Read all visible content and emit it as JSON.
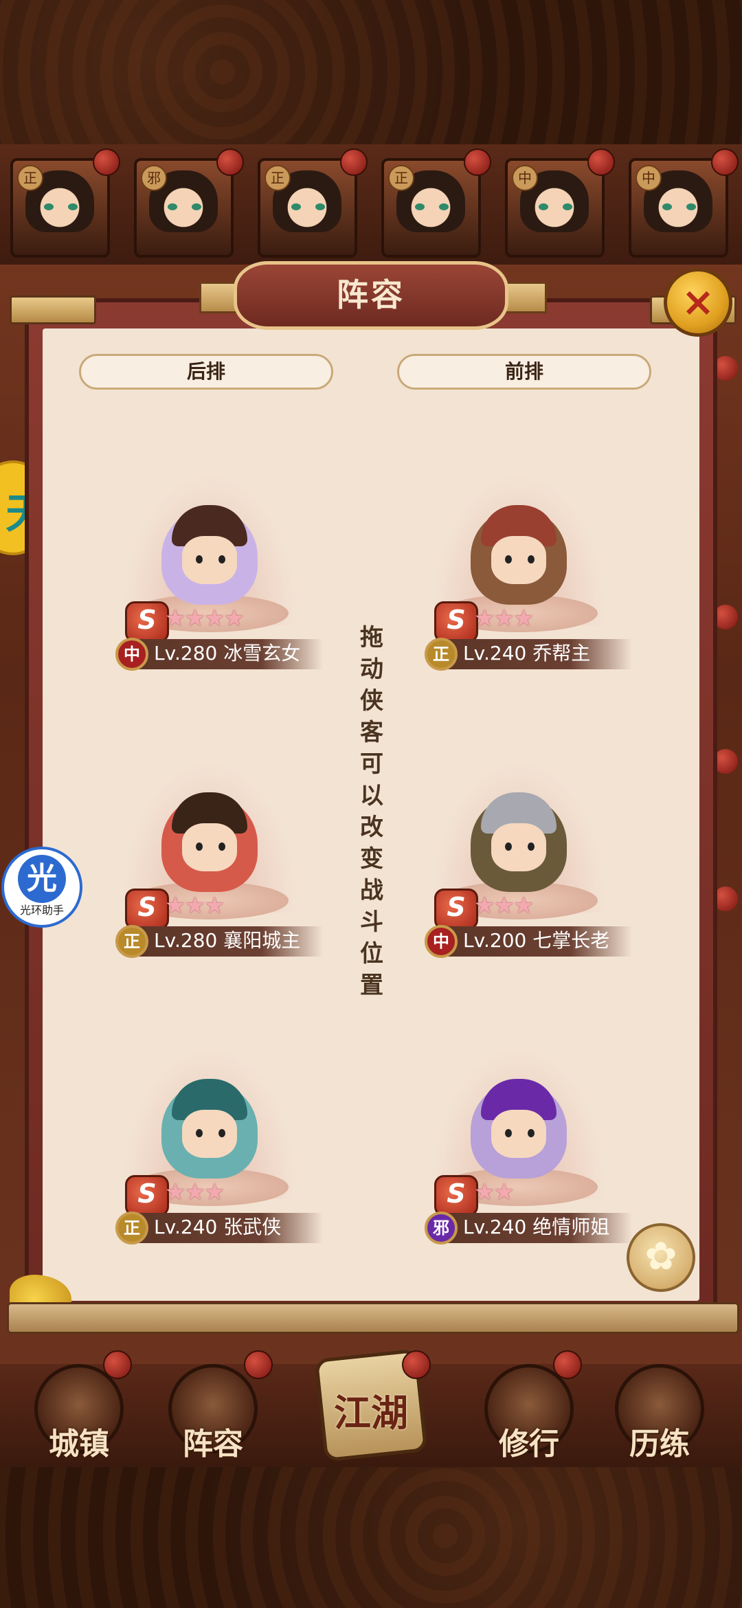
{
  "top_heroes": [
    {
      "faction": "正",
      "stars": "★★★"
    },
    {
      "faction": "邪",
      "stars": "★★★"
    },
    {
      "faction": "正",
      "stars": "★★★"
    },
    {
      "faction": "正",
      "stars": "★★★"
    },
    {
      "faction": "中",
      "stars": "★★★"
    },
    {
      "faction": "中",
      "stars": "★★★★"
    }
  ],
  "panel": {
    "title": "阵容",
    "close_icon": "×",
    "left_column": "后排",
    "right_column": "前排",
    "drag_hint": "拖动侠客可以改变战斗位置"
  },
  "lineup": [
    {
      "faction": "中",
      "faction_type": "zhong",
      "rank": "S",
      "stars": "★★★★",
      "level_name": "Lv.280 冰雪玄女",
      "color": "#c9b3e6",
      "hair": "#4a2a20"
    },
    {
      "faction": "正",
      "faction_type": "zheng",
      "rank": "S",
      "stars": "★★★",
      "level_name": "Lv.240 乔帮主",
      "color": "#8a5a3a",
      "hair": "#9a4030"
    },
    {
      "faction": "正",
      "faction_type": "zheng",
      "rank": "S",
      "stars": "★★★",
      "level_name": "Lv.280 襄阳城主",
      "color": "#d65a4a",
      "hair": "#3a2418"
    },
    {
      "faction": "中",
      "faction_type": "zhong",
      "rank": "S",
      "stars": "★★★",
      "level_name": "Lv.200 七掌长老",
      "color": "#6a5a3a",
      "hair": "#a8a8b0"
    },
    {
      "faction": "正",
      "faction_type": "zheng",
      "rank": "S",
      "stars": "★★★",
      "level_name": "Lv.240 张武侠",
      "color": "#6ab0b0",
      "hair": "#2a6a6a"
    },
    {
      "faction": "邪",
      "faction_type": "xie",
      "rank": "S",
      "stars": "★★",
      "level_name": "Lv.240 绝情师姐",
      "color": "#b8a0d8",
      "hair": "#6a2aa8"
    }
  ],
  "spin_icon": "✿",
  "assist": {
    "char": "光",
    "label": "光环助手"
  },
  "left_peek_char": "天",
  "nav": [
    {
      "label": "城镇"
    },
    {
      "label": "阵容"
    },
    {
      "label": "江湖"
    },
    {
      "label": "修行"
    },
    {
      "label": "历练"
    }
  ]
}
